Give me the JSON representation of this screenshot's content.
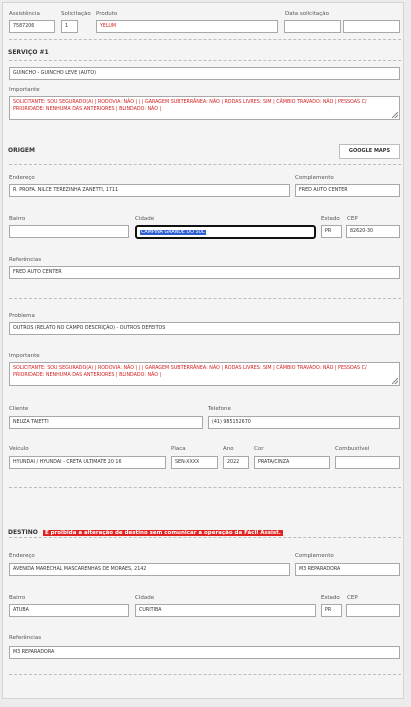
{
  "header": {
    "assistencia_label": "Assistência",
    "assistencia_value": "7587206",
    "solicitacao_label": "Solicitação",
    "solicitacao_value": "1",
    "produto_label": "Produto",
    "produto_value": "YELUM",
    "data_solicitacao_label": "Data solicitação",
    "data_value": "",
    "hora_value": ""
  },
  "servico": {
    "title": "SERVIÇO #1",
    "servico_value": "GUINCHO - GUINCHO LEVE (AUTO)",
    "importante_label": "Importante",
    "importante_text": "SOLICITANTE: SOU SEGURADO(A) | RODOVIA: NÃO | | | GARAGEM SUBTERRÂNEA: NÃO | RODAS LIVRES: SIM | CÂMBIO TRAVADO: NÃO | PESSOAS C/ PRIORIDADE: NENHUMA DAS ANTERIORES | BLINDADO: NÃO |"
  },
  "origem": {
    "title": "ORIGEM",
    "google_maps_button": "GOOGLE MAPS",
    "endereco_label": "Endereço",
    "endereco_value": "R. PROFA. NILCE TEREZINHA ZANETTI, 1711",
    "complemento_label": "Complemento",
    "complemento_value": "FRED AUTO CENTER",
    "bairro_label": "Bairro",
    "bairro_value": "",
    "cidade_label": "Cidade",
    "cidade_value": "CAMPINA GRANDE DO SUL",
    "estado_label": "Estado",
    "estado_value": "PR",
    "cep_label": "CEP",
    "cep_value": "82620-30",
    "referencias_label": "Referências",
    "referencias_value": "FRED AUTO CENTER"
  },
  "detalhes": {
    "problema_label": "Problema",
    "problema_value": "OUTROS (RELATO NO CAMPO DESCRIÇÃO) - OUTROS DEFEITOS",
    "importante_label": "Importante",
    "importante_text": "SOLICITANTE: SOU SEGURADO(A) | RODOVIA: NÃO | | | GARAGEM SUBTERRÂNEA: NÃO | RODAS LIVRES: SIM | CÂMBIO TRAVADO: NÃO | PESSOAS C/ PRIORIDADE: NENHUMA DAS ANTERIORES | BLINDADO: NÃO |",
    "cliente_label": "Cliente",
    "cliente_value": "NEUZA TAIETTI",
    "telefone_label": "Telefone",
    "telefone_value": "(41) 985152670",
    "veiculo_label": "Veículo",
    "veiculo_value": "HYUNDAI / HYUNDAI - CRETA ULTIMATE 20 16",
    "placa_label": "Placa",
    "placa_value": "SEN-XXXX",
    "ano_label": "Ano",
    "ano_value": "2022",
    "cor_label": "Cor",
    "cor_value": "PRATA/CINZA",
    "combustivel_label": "Combustível",
    "combustivel_value": ""
  },
  "destino": {
    "title": "DESTINO",
    "warning": "É proibida a alteração de destino sem comunicar a operação da Fácil Assist.",
    "endereco_label": "Endereço",
    "endereco_value": "AVENIDA MARECHAL MASCARENHAS DE MORAES, 2142",
    "complemento_label": "Complemento",
    "complemento_value": "M3 REPARADORA",
    "bairro_label": "Bairro",
    "bairro_value": "ATUBA",
    "cidade_label": "Cidade",
    "cidade_value": "CURITIBA",
    "estado_label": "Estado",
    "estado_value": "PR",
    "cep_label": "CEP",
    "cep_value": "",
    "referencias_label": "Referências",
    "referencias_value": "M3 REPARADORA"
  },
  "colors": {
    "important_text": "#d32020",
    "warning_bg": "#e02424",
    "selection": "#2f5fd0"
  }
}
